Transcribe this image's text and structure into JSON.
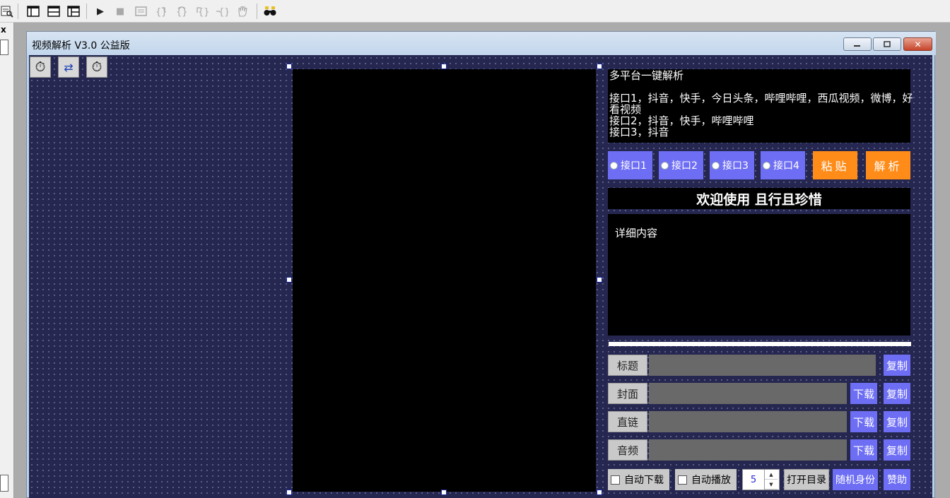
{
  "ide_toolbar": {
    "icons": [
      "preview-icon",
      "layout-single-icon",
      "layout-split-icon",
      "layout-grid-icon",
      "run-icon",
      "stop-icon",
      "debug-window-icon",
      "step-into-icon",
      "step-over-icon",
      "step-out-icon",
      "run-to-cursor-icon",
      "breakpoint-hand-icon",
      "binoculars-icon"
    ],
    "glyphs": {
      "run": "▶",
      "stop": "■"
    }
  },
  "left_strip": {
    "close": "x"
  },
  "window": {
    "title": "视频解析 V3.0 公益版",
    "buttons": {
      "minimize": "—",
      "maximize": "□",
      "close": "✕"
    }
  },
  "components": {
    "timer1": "⏱",
    "timer2": "⏱",
    "network": "⇄"
  },
  "info_box": {
    "lines": [
      "多平台一键解析",
      "",
      "接口1，抖音，快手，今日头条，哔哩哔哩，西瓜视频，微博，好",
      "看视频",
      "接口2，抖音，快手，哔哩哔哩",
      "接口3，抖音"
    ]
  },
  "interfaces": [
    "接口1",
    "接口2",
    "接口3",
    "接口4"
  ],
  "buttons": {
    "paste": "粘贴",
    "parse": "解析"
  },
  "welcome": "欢迎使用 且行且珍惜",
  "detail": "详细内容",
  "rows": [
    {
      "label": "标题",
      "download": "",
      "copy": "复制"
    },
    {
      "label": "封面",
      "download": "下载",
      "copy": "复制"
    },
    {
      "label": "直链",
      "download": "下载",
      "copy": "复制"
    },
    {
      "label": "音频",
      "download": "下载",
      "copy": "复制"
    }
  ],
  "bottom": {
    "auto_download": "自动下载",
    "auto_play": "自动播放",
    "spin_value": "5",
    "spin_up": "▲",
    "spin_down": "▼",
    "open_dir": "打开目录",
    "random_id": "随机身份",
    "sponsor": "赞助"
  },
  "colors": {
    "form_bg": "#252750",
    "accent_blue": "#6e6ef5",
    "accent_orange": "#ff8c19",
    "field_gray": "#696969"
  }
}
